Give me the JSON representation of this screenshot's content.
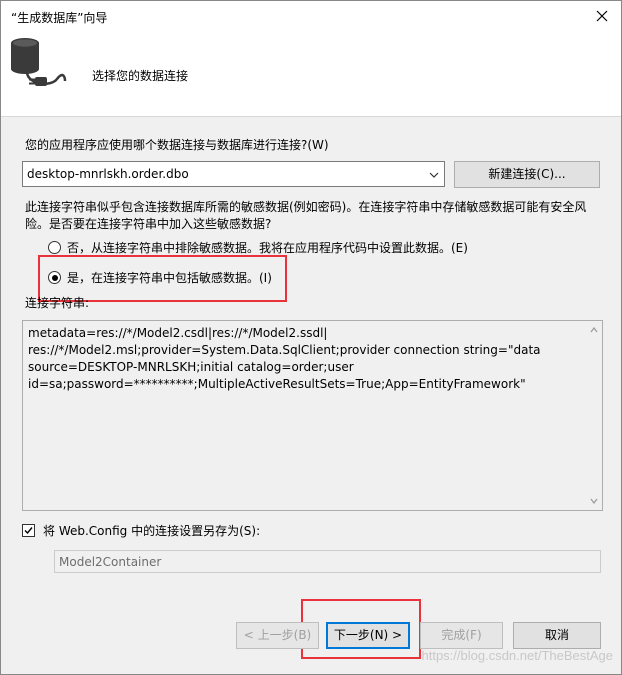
{
  "window": {
    "title": "“生成数据库”向导"
  },
  "header": {
    "title": "选择您的数据连接"
  },
  "question": "您的应用程序应使用哪个数据连接与数据库进行连接?(W)",
  "connection": {
    "selected": "desktop-mnrlskh.order.dbo",
    "new_button": "新建连接(C)..."
  },
  "warning_text": "此连接字符串似乎包含连接数据库所需的敏感数据(例如密码)。在连接字符串中存储敏感数据可能有安全风险。是否要在连接字符串中加入这些敏感数据?",
  "options": {
    "exclude": "否，从连接字符串中排除敏感数据。我将在应用程序代码中设置此数据。(E)",
    "include": "是，在连接字符串中包括敏感数据。(I)",
    "selected": "include"
  },
  "connstr": {
    "label": "连接字符串:",
    "value": "metadata=res://*/Model2.csdl|res://*/Model2.ssdl|\nres://*/Model2.msl;provider=System.Data.SqlClient;provider connection string=\"data\nsource=DESKTOP-MNRLSKH;initial catalog=order;user\nid=sa;password=**********;MultipleActiveResultSets=True;App=EntityFramework\""
  },
  "save": {
    "checked": true,
    "label": "将 Web.Config 中的连接设置另存为(S):",
    "value": "Model2Container"
  },
  "buttons": {
    "back": "< 上一步(B)",
    "next": "下一步(N) >",
    "finish": "完成(F)",
    "cancel": "取消"
  },
  "watermark": "https://blog.csdn.net/TheBestAge",
  "colors": {
    "highlight": "#e8333a",
    "accent": "#0078d7"
  }
}
